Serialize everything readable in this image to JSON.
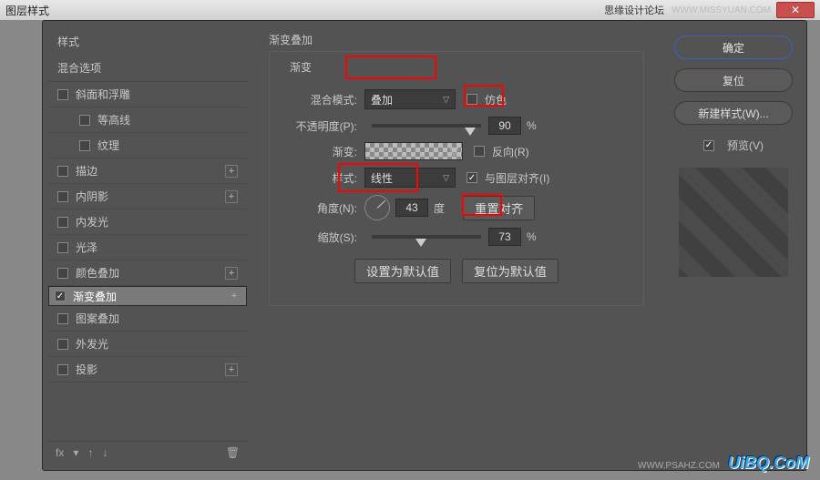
{
  "titlebar": {
    "title": "图层样式",
    "right_text": "思缘设计论坛",
    "watermark": "WWW.MISSYUAN.COM"
  },
  "left": {
    "header": "样式",
    "subheader": "混合选项",
    "items": [
      {
        "label": "斜面和浮雕",
        "checked": false,
        "indent": false,
        "plus": false
      },
      {
        "label": "等高线",
        "checked": false,
        "indent": true,
        "plus": false
      },
      {
        "label": "纹理",
        "checked": false,
        "indent": true,
        "plus": false
      },
      {
        "label": "描边",
        "checked": false,
        "indent": false,
        "plus": true
      },
      {
        "label": "内阴影",
        "checked": false,
        "indent": false,
        "plus": true
      },
      {
        "label": "内发光",
        "checked": false,
        "indent": false,
        "plus": false
      },
      {
        "label": "光泽",
        "checked": false,
        "indent": false,
        "plus": false
      },
      {
        "label": "颜色叠加",
        "checked": false,
        "indent": false,
        "plus": true
      },
      {
        "label": "渐变叠加",
        "checked": true,
        "indent": false,
        "plus": true,
        "selected": true
      },
      {
        "label": "图案叠加",
        "checked": false,
        "indent": false,
        "plus": false
      },
      {
        "label": "外发光",
        "checked": false,
        "indent": false,
        "plus": false
      },
      {
        "label": "投影",
        "checked": false,
        "indent": false,
        "plus": true
      }
    ],
    "foot_fx": "fx"
  },
  "mid": {
    "section_title": "渐变叠加",
    "legend": "渐变",
    "blend_label": "混合模式:",
    "blend_value": "叠加",
    "dither": "仿色",
    "opacity_label": "不透明度(P):",
    "opacity_value": "90",
    "pct": "%",
    "gradient_label": "渐变:",
    "reverse": "反向(R)",
    "style_label": "样式:",
    "style_value": "线性",
    "align": "与图层对齐(I)",
    "angle_label": "角度(N):",
    "angle_value": "43",
    "degree": "度",
    "reset_align": "重置对齐",
    "scale_label": "缩放(S):",
    "scale_value": "73",
    "set_default": "设置为默认值",
    "reset_default": "复位为默认值"
  },
  "right": {
    "ok": "确定",
    "reset": "复位",
    "new_style": "新建样式(W)...",
    "preview": "预览(V)"
  },
  "footer": {
    "logo": "UiBQ.CoM",
    "wm": "WWW.PSAHZ.COM"
  }
}
